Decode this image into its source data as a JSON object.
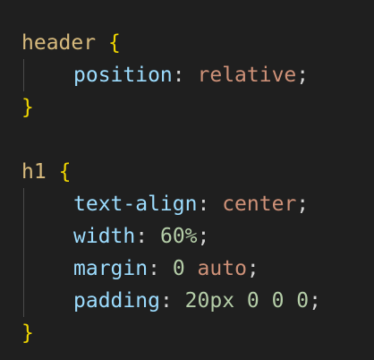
{
  "editor": {
    "rules": [
      {
        "selector": "header",
        "open_brace": "{",
        "close_brace": "}",
        "declarations": [
          {
            "property": "position",
            "colon": ":",
            "value": "relative",
            "semicolon": ";"
          }
        ]
      },
      {
        "selector": "h1",
        "open_brace": "{",
        "close_brace": "}",
        "declarations": [
          {
            "property": "text-align",
            "colon": ":",
            "value": "center",
            "semicolon": ";"
          },
          {
            "property": "width",
            "colon": ":",
            "value": "60%",
            "semicolon": ";"
          },
          {
            "property": "margin",
            "colon": ":",
            "value_num": "0",
            "value_kw": "auto",
            "semicolon": ";"
          },
          {
            "property": "padding",
            "colon": ":",
            "value": "20px 0 0 0",
            "semicolon": ";"
          }
        ]
      }
    ],
    "colors": {
      "background": "#1f1f1f",
      "selector": "#d7ba7d",
      "brace": "#f1d700",
      "property": "#9cdcfe",
      "string_value": "#ce9178",
      "numeric_value": "#b5cea8",
      "punctuation": "#d4d4d4"
    }
  }
}
